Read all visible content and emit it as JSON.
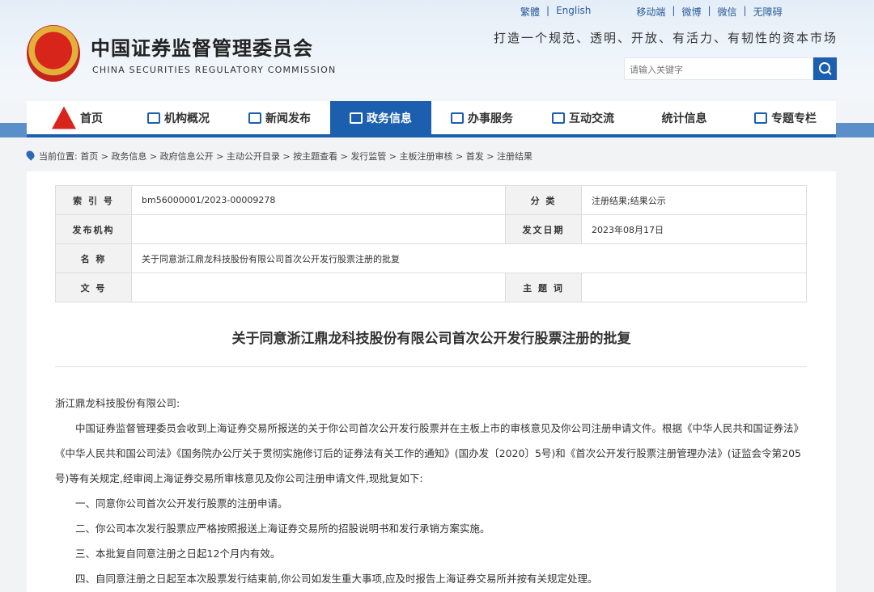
{
  "header": {
    "org_cn": "中国证券监督管理委员会",
    "org_en": "CHINA SECURITIES REGULATORY COMMISSION",
    "slogan": "打造一个规范、透明、开放、有活力、有韧性的资本市场",
    "search_placeholder": "请输入关键字",
    "toplinks": [
      "繁體",
      "English",
      "移动端",
      "微博",
      "微信",
      "无障碍"
    ]
  },
  "nav": [
    "首页",
    "机构概况",
    "新闻发布",
    "政务信息",
    "办事服务",
    "互动交流",
    "统计信息",
    "专题专栏"
  ],
  "breadcrumb": {
    "prefix": "当前位置:",
    "items": [
      "首页",
      "政务信息",
      "政府信息公开",
      "主动公开目录",
      "按主题查看",
      "发行监管",
      "主板注册审核",
      "首发",
      "注册结果"
    ]
  },
  "meta": {
    "index_label": "索 引 号",
    "index": "bm56000001/2023-00009278",
    "category_label": "分 类",
    "category": "注册结果;结果公示",
    "issuer_label": "发布机构",
    "issuer": "",
    "date_label": "发文日期",
    "date": "2023年08月17日",
    "name_label": "名 称",
    "name": "关于同意浙江鼎龙科技股份有限公司首次公开发行股票注册的批复",
    "docno_label": "文 号",
    "docno": "",
    "subject_label": "主 题 词",
    "subject": ""
  },
  "article": {
    "title": "关于同意浙江鼎龙科技股份有限公司首次公开发行股票注册的批复",
    "salutation": "浙江鼎龙科技股份有限公司:",
    "paragraph": "中国证券监督管理委员会收到上海证券交易所报送的关于你公司首次公开发行股票并在主板上市的审核意见及你公司注册申请文件。根据《中华人民共和国证券法》《中华人民共和国公司法》《国务院办公厅关于贯彻实施修订后的证券法有关工作的通知》(国办发〔2020〕5号)和《首次公开发行股票注册管理办法》(证监会令第205号)等有关规定,经审阅上海证券交易所审核意见及你公司注册申请文件,现批复如下:",
    "items": [
      "一、同意你公司首次公开发行股票的注册申请。",
      "二、你公司本次发行股票应严格按照报送上海证券交易所的招股说明书和发行承销方案实施。",
      "三、本批复自同意注册之日起12个月内有效。",
      "四、自同意注册之日起至本次股票发行结束前,你公司如发生重大事项,应及时报告上海证券交易所并按有关规定处理。"
    ]
  }
}
